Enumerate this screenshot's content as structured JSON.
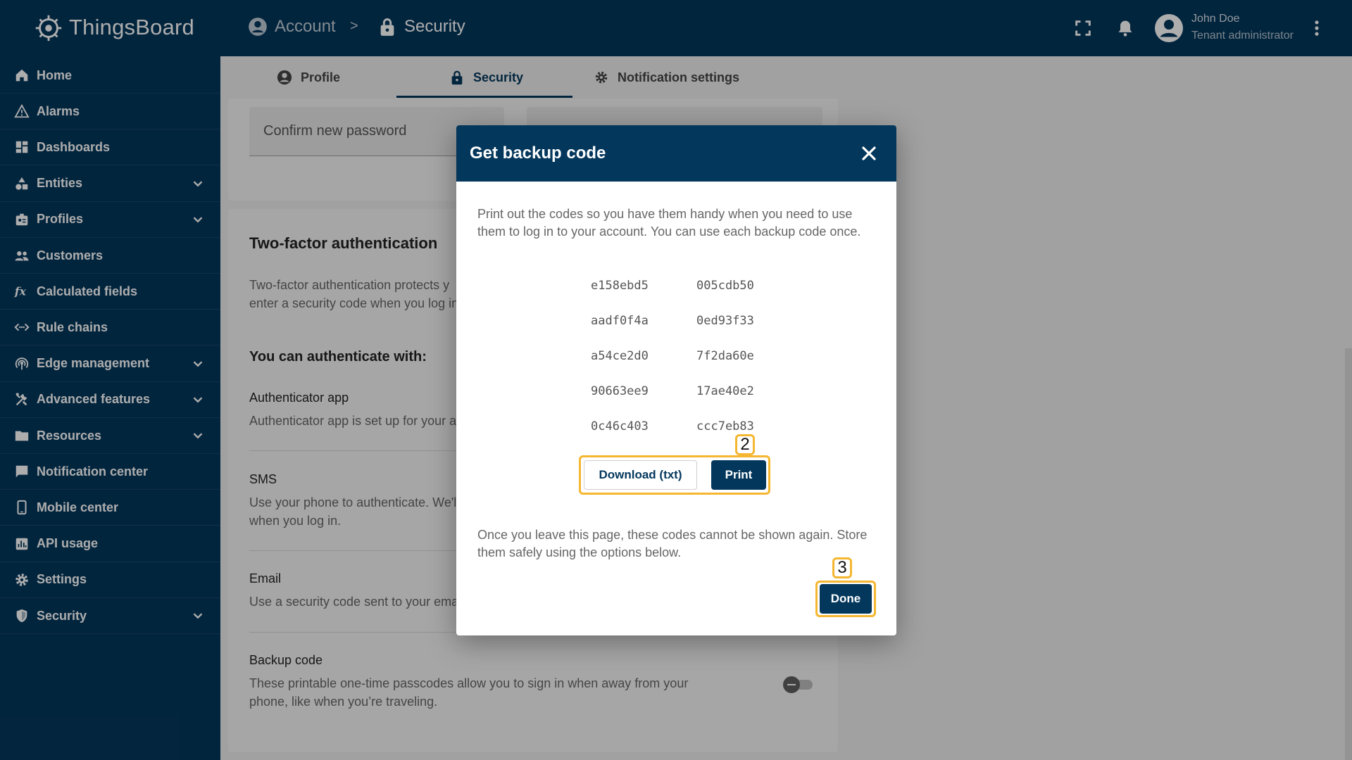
{
  "app": {
    "name": "ThingsBoard"
  },
  "breadcrumb": {
    "account": "Account",
    "separator": ">",
    "security": "Security"
  },
  "user": {
    "name": "John Doe",
    "role": "Tenant administrator"
  },
  "sidebar": {
    "items": [
      {
        "label": "Home",
        "icon": "home-icon",
        "expandable": false
      },
      {
        "label": "Alarms",
        "icon": "warning-icon",
        "expandable": false
      },
      {
        "label": "Dashboards",
        "icon": "dashboard-icon",
        "expandable": false
      },
      {
        "label": "Entities",
        "icon": "entities-icon",
        "expandable": true
      },
      {
        "label": "Profiles",
        "icon": "profiles-icon",
        "expandable": true
      },
      {
        "label": "Customers",
        "icon": "customers-icon",
        "expandable": false
      },
      {
        "label": "Calculated fields",
        "icon": "function-icon",
        "expandable": false
      },
      {
        "label": "Rule chains",
        "icon": "rule-chains-icon",
        "expandable": false
      },
      {
        "label": "Edge management",
        "icon": "edge-icon",
        "expandable": true
      },
      {
        "label": "Advanced features",
        "icon": "tools-icon",
        "expandable": true
      },
      {
        "label": "Resources",
        "icon": "folder-icon",
        "expandable": true
      },
      {
        "label": "Notification center",
        "icon": "notification-center-icon",
        "expandable": false
      },
      {
        "label": "Mobile center",
        "icon": "mobile-icon",
        "expandable": false
      },
      {
        "label": "API usage",
        "icon": "api-usage-icon",
        "expandable": false
      },
      {
        "label": "Settings",
        "icon": "gear-icon",
        "expandable": false
      },
      {
        "label": "Security",
        "icon": "shield-icon",
        "expandable": true
      }
    ]
  },
  "tabs": {
    "profile": "Profile",
    "security": "Security",
    "notifications": "Notification settings"
  },
  "password": {
    "confirm_placeholder": "Confirm new password"
  },
  "tfa": {
    "title": "Two-factor authentication",
    "description": "Two-factor authentication protects y enter a security code when you log in",
    "description_line1": "Two-factor authentication protects y",
    "description_line2": "enter a security code when you log in",
    "auth_with": "You can authenticate with:",
    "methods": {
      "app": {
        "title": "Authenticator app",
        "desc": "Authenticator app is set up for your a"
      },
      "sms": {
        "title": "SMS",
        "desc_line1": "Use your phone to authenticate. We'l",
        "desc_line2": "when you log in."
      },
      "email": {
        "title": "Email",
        "desc": "Use a security code sent to your ema"
      },
      "backup": {
        "title": "Backup code",
        "desc_line1": "These printable one-time passcodes allow you to sign in when away from your",
        "desc_line2": "phone, like when you’re traveling."
      }
    }
  },
  "dialog": {
    "title": "Get backup code",
    "intro": "Print out the codes so you have them handy when you need to use them to log in to your account. You can use each backup code once.",
    "codes": [
      [
        "e158ebd5",
        "005cdb50"
      ],
      [
        "aadf0f4a",
        "0ed93f33"
      ],
      [
        "a54ce2d0",
        "7f2da60e"
      ],
      [
        "90663ee9",
        "17ae40e2"
      ],
      [
        "0c46c403",
        "ccc7eb83"
      ]
    ],
    "download_label": "Download (txt)",
    "print_label": "Print",
    "warning": "Once you leave this page, these codes cannot be shown again. Store them safely using the options below.",
    "done_label": "Done",
    "step_badges": {
      "print": "2",
      "done": "3"
    }
  },
  "colors": {
    "primary": "#04375c",
    "highlight": "#f5b731"
  }
}
